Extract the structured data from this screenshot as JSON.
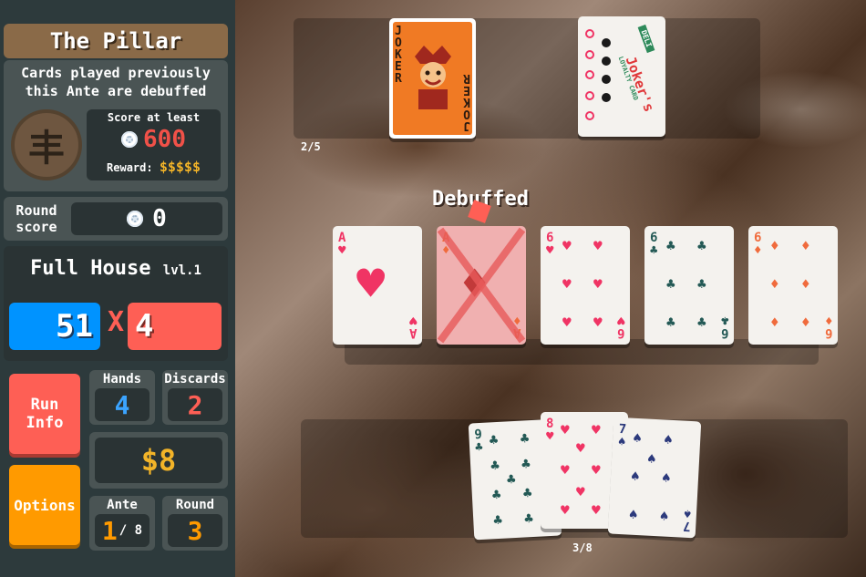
{
  "blind": {
    "name": "The Pillar",
    "description_line1": "Cards played previously",
    "description_line2": "this Ante are debuffed",
    "badge_glyph": "丰",
    "score_label": "Score at least",
    "score_target": "600",
    "reward_label": "Reward:",
    "reward_value": "$$$$$"
  },
  "round_score": {
    "label_line1": "Round",
    "label_line2": "score",
    "value": "0"
  },
  "hand": {
    "name": "Full House",
    "level": "lvl.1",
    "chips": "51",
    "times": "X",
    "mult": "4"
  },
  "buttons": {
    "run_info_line1": "Run",
    "run_info_line2": "Info",
    "options": "Options"
  },
  "stats": {
    "hands_label": "Hands",
    "hands_value": "4",
    "discards_label": "Discards",
    "discards_value": "2",
    "money": "$8",
    "ante_label": "Ante",
    "ante_value": "1",
    "ante_total": "/ 8",
    "round_label": "Round",
    "round_value": "3"
  },
  "jokers": {
    "count": "2/5",
    "joker1": {
      "name": "JOKER",
      "name_reversed": "JOKER"
    },
    "joker2": {
      "title": "Joker's",
      "badge": "DELI",
      "sub": "LOYALTY CARD"
    }
  },
  "played": {
    "debuff_label": "Debuffed",
    "cards": [
      {
        "rank": "A",
        "suit": "hearts",
        "symbol": "♥"
      },
      {
        "rank": "A",
        "suit": "diamonds",
        "symbol": "♦"
      },
      {
        "rank": "6",
        "suit": "hearts",
        "symbol": "♥"
      },
      {
        "rank": "6",
        "suit": "clubs",
        "symbol": "♣"
      },
      {
        "rank": "6",
        "suit": "diamonds",
        "symbol": "♦"
      }
    ]
  },
  "held": {
    "count": "3/8",
    "cards": [
      {
        "rank": "9",
        "suit": "clubs",
        "symbol": "♣"
      },
      {
        "rank": "8",
        "suit": "hearts",
        "symbol": "♥"
      },
      {
        "rank": "7",
        "suit": "spades",
        "symbol": "♠"
      }
    ]
  }
}
